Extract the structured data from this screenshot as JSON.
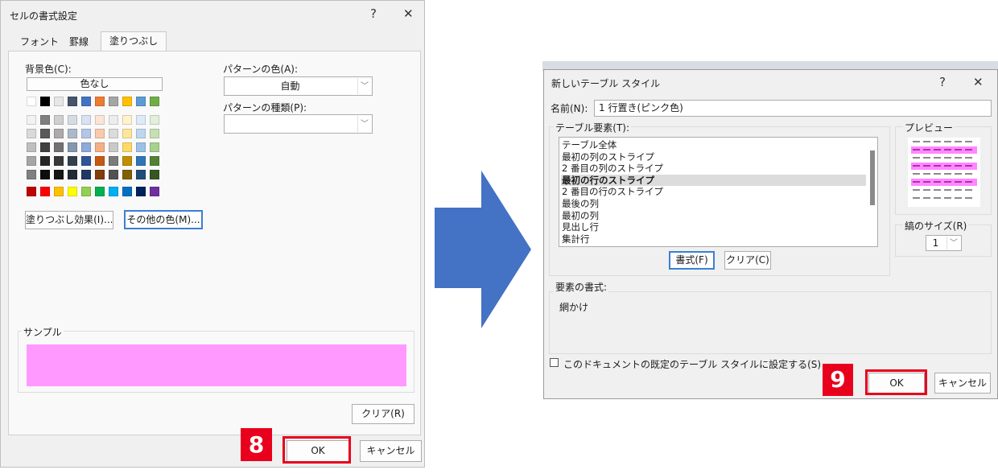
{
  "dialog1": {
    "title": "セルの書式設定",
    "help": "?",
    "close": "✕",
    "tabs": [
      "フォント",
      "罫線",
      "塗りつぶし"
    ],
    "bg_color_label": "背景色(C):",
    "no_color_label": "色なし",
    "pattern_color_label": "パターンの色(A):",
    "pattern_color_value": "自動",
    "pattern_type_label": "パターンの種類(P):",
    "pattern_type_value": "",
    "fill_effects_label": "塗りつぶし効果(I)...",
    "more_colors_label": "その他の色(M)...",
    "sample_label": "サンプル",
    "sample_color": "#ff99ff",
    "clear_label": "クリア(R)",
    "ok_label": "OK",
    "cancel_label": "キャンセル",
    "step_badge": "8"
  },
  "palette": {
    "top_row": [
      "#ffffff",
      "#000000",
      "#e7e6e6",
      "#44546a",
      "#4472c4",
      "#ed7d31",
      "#a5a5a5",
      "#ffc000",
      "#5b9bd5",
      "#70ad47"
    ],
    "tints": [
      [
        "#f2f2f2",
        "#7f7f7f",
        "#d0cece",
        "#d6dce4",
        "#d9e1f2",
        "#fce4d6",
        "#ededed",
        "#fff2cc",
        "#ddebf7",
        "#e2efda"
      ],
      [
        "#d9d9d9",
        "#595959",
        "#aeaaaa",
        "#acb9ca",
        "#b4c6e7",
        "#f8cbad",
        "#dbdbdb",
        "#ffe699",
        "#bdd7ee",
        "#c6e0b4"
      ],
      [
        "#bfbfbf",
        "#404040",
        "#757171",
        "#8497b0",
        "#8ea9db",
        "#f4b084",
        "#c9c9c9",
        "#ffd966",
        "#9bc2e6",
        "#a9d08e"
      ],
      [
        "#a6a6a6",
        "#262626",
        "#3a3838",
        "#333f4f",
        "#2f5597",
        "#c65911",
        "#7b7b7b",
        "#bf8f00",
        "#2e75b6",
        "#548235"
      ],
      [
        "#808080",
        "#0d0d0d",
        "#161616",
        "#222b35",
        "#203764",
        "#833c0c",
        "#525252",
        "#806000",
        "#1f4e78",
        "#375623"
      ]
    ],
    "standard": [
      "#c00000",
      "#ff0000",
      "#ffc000",
      "#ffff00",
      "#92d050",
      "#00b050",
      "#00b0f0",
      "#0070c0",
      "#002060",
      "#7030a0"
    ]
  },
  "arrow_color": "#4472c4",
  "dialog2": {
    "title": "新しいテーブル スタイル",
    "help": "?",
    "close": "✕",
    "name_label": "名前(N):",
    "name_value": "1 行置き(ピンク色)",
    "elements_label": "テーブル要素(T):",
    "elements": [
      "テーブル全体",
      "最初の列のストライプ",
      "2 番目の列のストライプ",
      "最初の行のストライプ",
      "2 番目の行のストライプ",
      "最後の列",
      "最初の列",
      "見出し行",
      "集計行"
    ],
    "selected_index": 3,
    "format_label": "書式(F)",
    "clear_label": "クリア(C)",
    "preview_label": "プレビュー",
    "stripe_size_label": "縞のサイズ(R)",
    "stripe_size_value": "1",
    "element_format_label": "要素の書式:",
    "element_format_value": "網かけ",
    "default_checkbox_label": "このドキュメントの既定のテーブル スタイルに設定する(S)",
    "ok_label": "OK",
    "cancel_label": "キャンセル",
    "step_badge": "9",
    "preview_highlight": "#ff88ff"
  }
}
